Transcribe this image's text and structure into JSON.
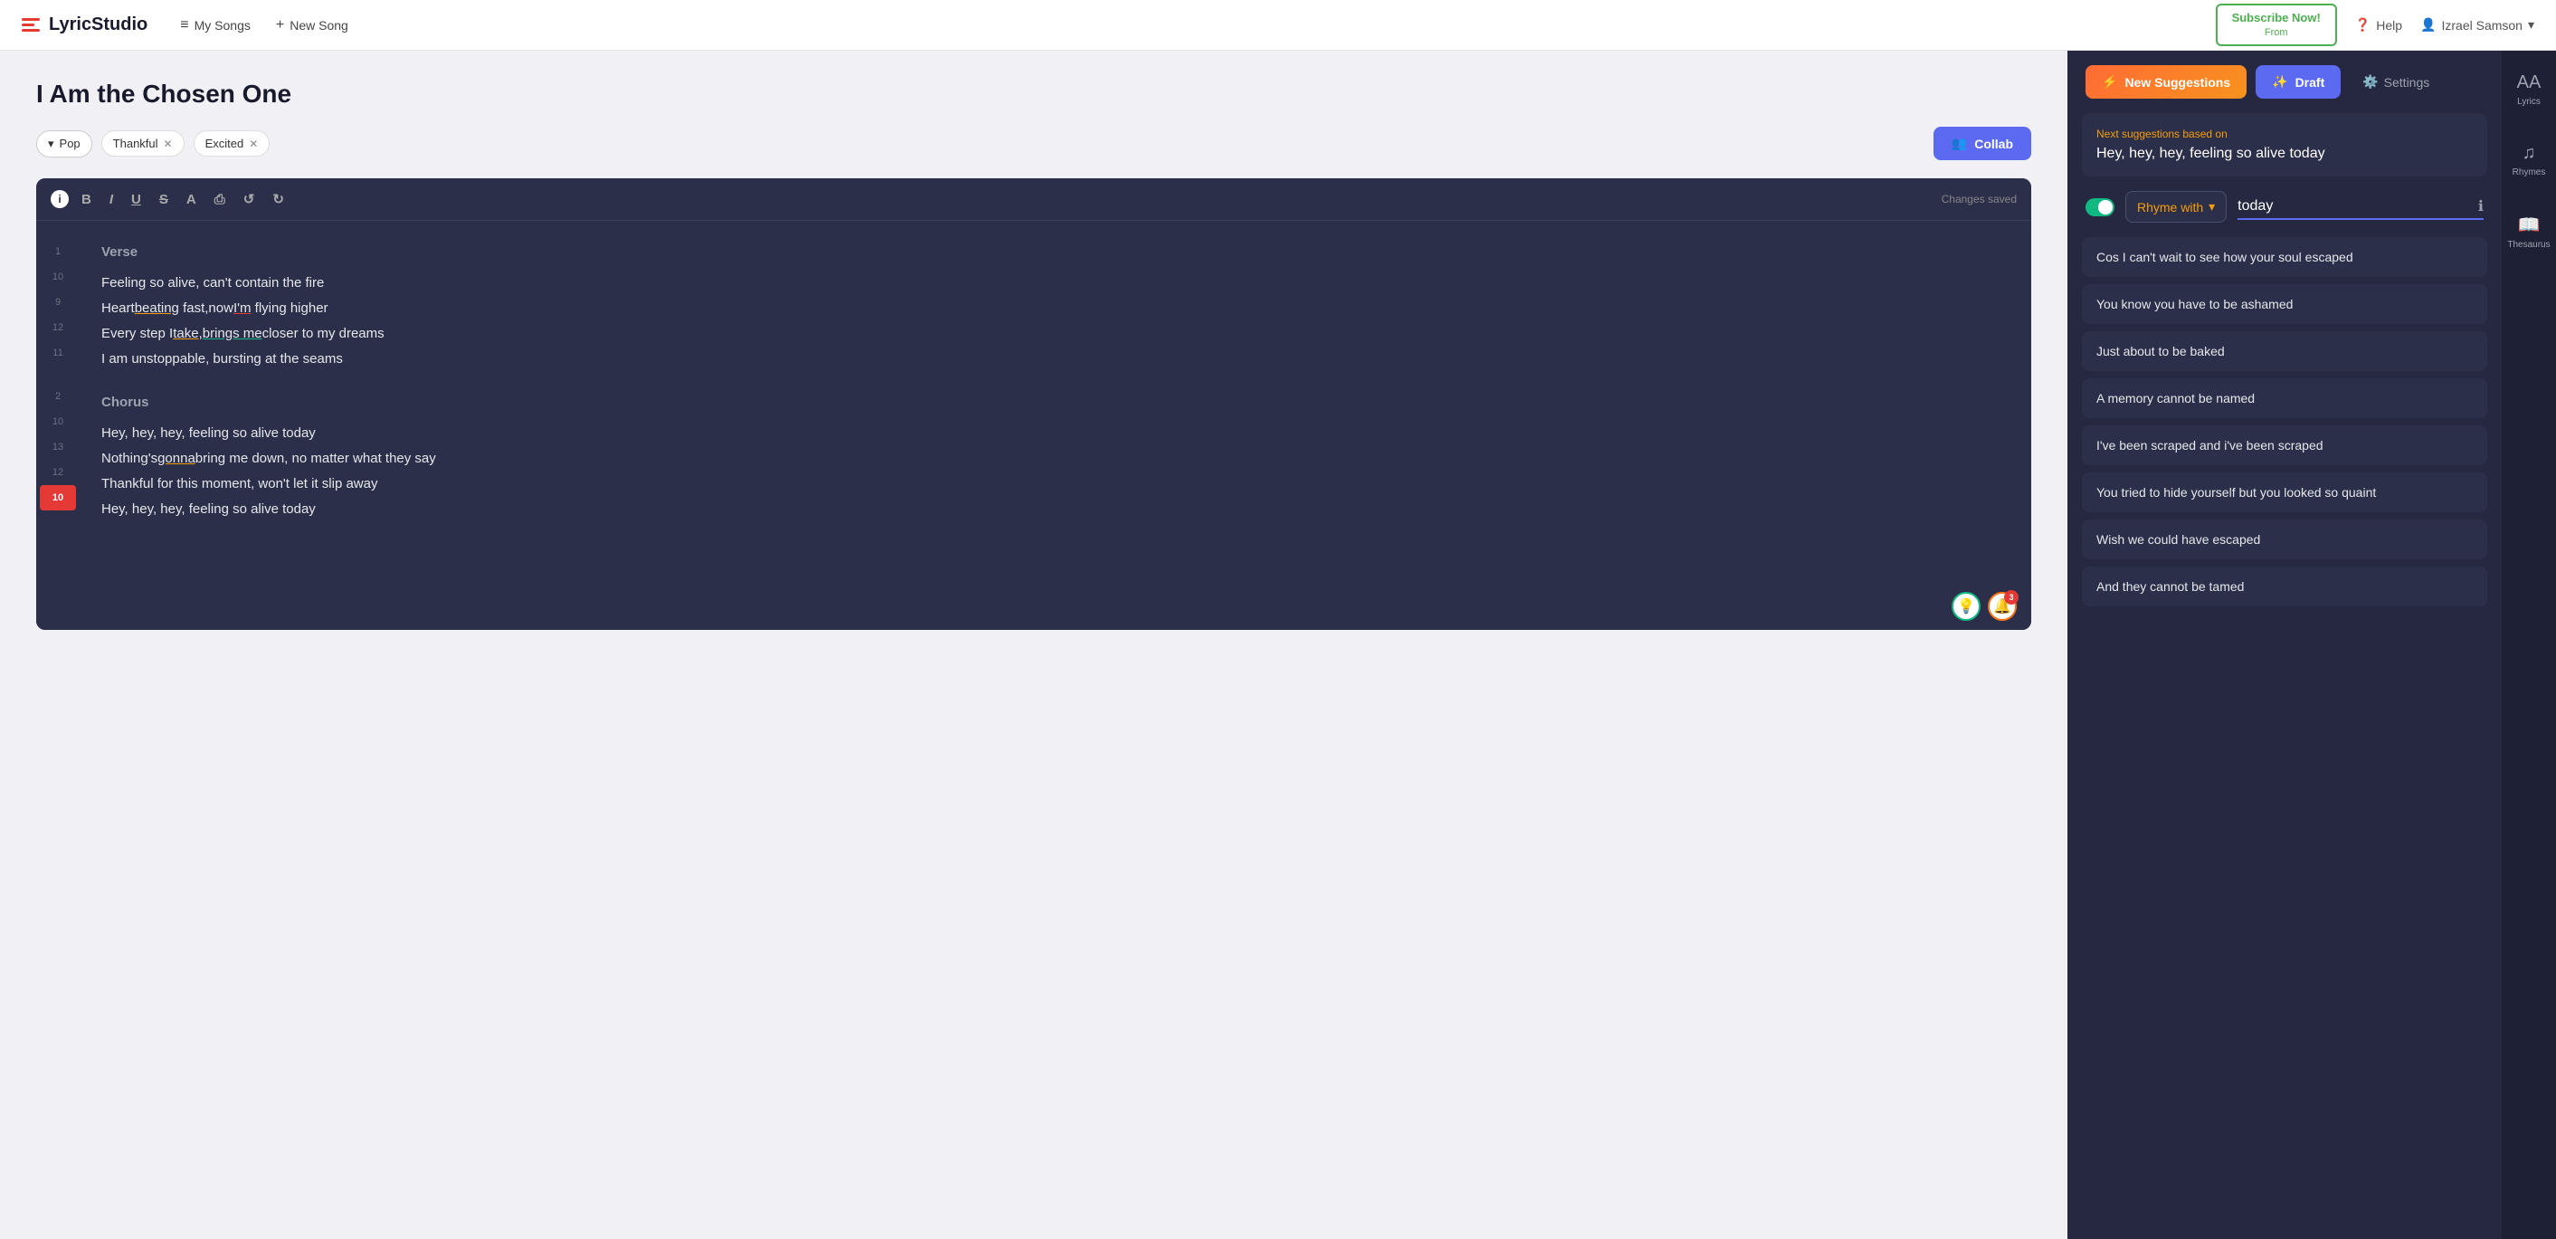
{
  "header": {
    "logo_bars": true,
    "app_name": "LyricStudio",
    "nav": [
      {
        "icon": "≡",
        "label": "My Songs"
      },
      {
        "icon": "+",
        "label": "New Song"
      }
    ],
    "subscribe_label": "Subscribe Now!",
    "subscribe_sub": "From",
    "help_label": "Help",
    "user_label": "Izrael Samson"
  },
  "editor": {
    "song_title": "I Am the Chosen One",
    "genre_tag": "Pop",
    "mood_tags": [
      "Thankful",
      "Excited"
    ],
    "collab_label": "Collab",
    "toolbar": {
      "bold": "B",
      "italic": "I",
      "underline": "U",
      "strikethrough": "S",
      "color": "A",
      "print": "⎙",
      "undo": "↺",
      "redo": "↻",
      "changes_saved": "Changes saved"
    },
    "sections": [
      {
        "type": "header",
        "line_num": "1",
        "text": "Verse"
      },
      {
        "type": "line",
        "line_num": "10",
        "text": "Feeling so alive, can't contain the fire"
      },
      {
        "type": "line",
        "line_num": "9",
        "text": "Heart beating fast, now I'm flying higher"
      },
      {
        "type": "line",
        "line_num": "12",
        "text": "Every step I take, brings me closer to my dreams"
      },
      {
        "type": "line",
        "line_num": "11",
        "text": "I am unstoppable, bursting at the seams"
      },
      {
        "type": "spacer"
      },
      {
        "type": "header",
        "line_num": "2",
        "text": "Chorus"
      },
      {
        "type": "line",
        "line_num": "10",
        "text": "Hey, hey, hey, feeling so alive today"
      },
      {
        "type": "line",
        "line_num": "13",
        "text": "Nothing's gonna bring me down, no matter what they say"
      },
      {
        "type": "line",
        "line_num": "12",
        "text": "Thankful for this moment, won't let it slip away"
      },
      {
        "type": "line",
        "line_num": "10",
        "text": "Hey, hey, hey, feeling so alive today",
        "highlight": true
      }
    ]
  },
  "suggestions_panel": {
    "tabs": {
      "new_suggestions": "New Suggestions",
      "draft": "Draft",
      "settings": "Settings"
    },
    "side_icons": [
      {
        "symbol": "AA",
        "label": "Lyrics"
      },
      {
        "symbol": "♫",
        "label": "Rhymes"
      },
      {
        "symbol": "📖",
        "label": "Thesaurus"
      }
    ],
    "next_suggestions_label": "Next suggestions based on",
    "next_suggestions_text": "Hey, hey, hey, feeling so alive today",
    "rhyme_toggle": true,
    "rhyme_with_label": "Rhyme with",
    "rhyme_input_value": "today",
    "suggestions": [
      "Cos I can't wait to see how your soul escaped",
      "You know you have to be ashamed",
      "Just about to be baked",
      "A memory cannot be named",
      "I've been scraped and i've been scraped",
      "You tried to hide yourself but you looked so quaint",
      "Wish we could have escaped",
      "And they cannot be tamed"
    ]
  }
}
